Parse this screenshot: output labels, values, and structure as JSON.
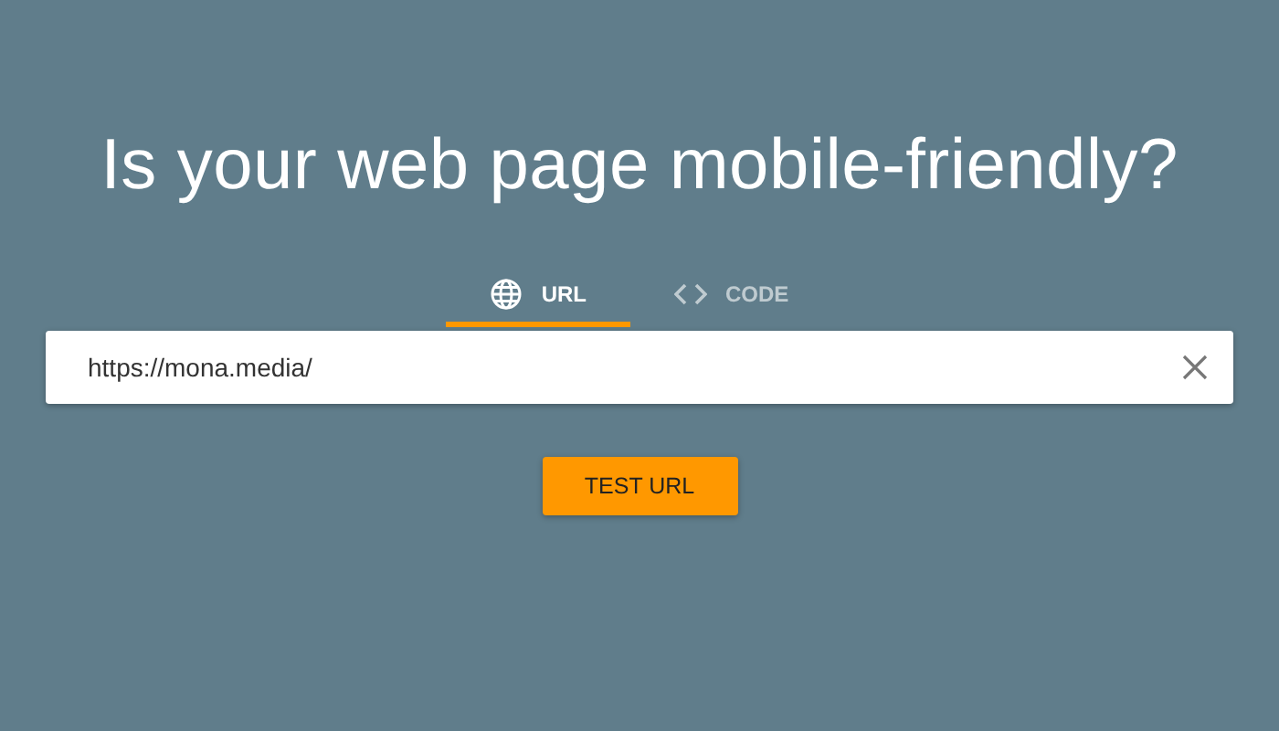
{
  "title": "Is your web page mobile-friendly?",
  "tabs": [
    {
      "label": "URL",
      "kind": "globe",
      "selected": true
    },
    {
      "label": "CODE",
      "kind": "code",
      "selected": false
    }
  ],
  "url_field": {
    "value": "https://mona.media/"
  },
  "test_button": {
    "label": "TEST URL"
  }
}
